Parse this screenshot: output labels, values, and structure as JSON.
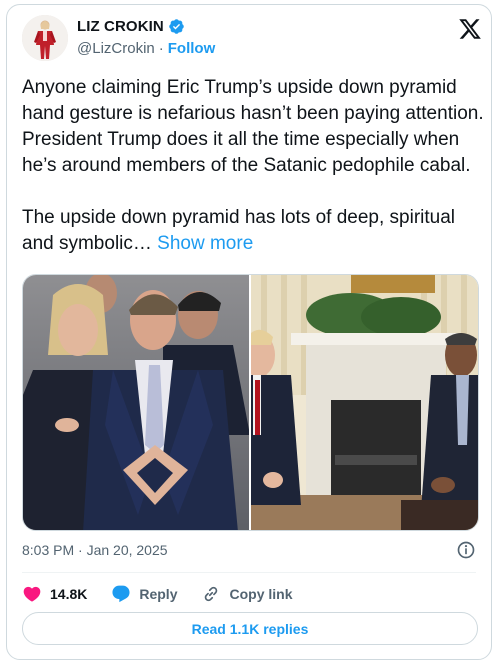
{
  "author": {
    "display_name": "LIZ CROKIN",
    "handle": "@LizCrokin",
    "separator": "·",
    "follow_label": "Follow",
    "verified_color": "#1d9bf0"
  },
  "tweet": {
    "text": "Anyone claiming Eric Trump’s upside down pyramid hand gesture is nefarious hasn’t been paying attention. President Trump does it all the time especially when he’s around members of the Satanic pedophile cabal.\n\nThe upside down pyramid has lots of deep, spiritual and symbolic… ",
    "show_more_label": "Show more",
    "timestamp": "8:03 PM · Jan 20, 2025"
  },
  "media": {
    "photos": [
      {
        "subject": "man-hand-gesture-photo"
      },
      {
        "subject": "oval-office-seated-photo"
      }
    ]
  },
  "actions": {
    "like_count": "14.8K",
    "reply_label": "Reply",
    "copy_link_label": "Copy link"
  },
  "replies": {
    "button_label": "Read 1.1K replies"
  },
  "colors": {
    "accent": "#1d9bf0",
    "like": "#f91880",
    "muted_text": "#536471",
    "border": "#cfd9de"
  },
  "icons": {
    "verified": "verified-badge-icon",
    "logo": "x-logo-icon",
    "info": "info-icon",
    "like": "heart-icon",
    "reply": "speech-bubble-icon",
    "copy_link": "link-icon"
  }
}
